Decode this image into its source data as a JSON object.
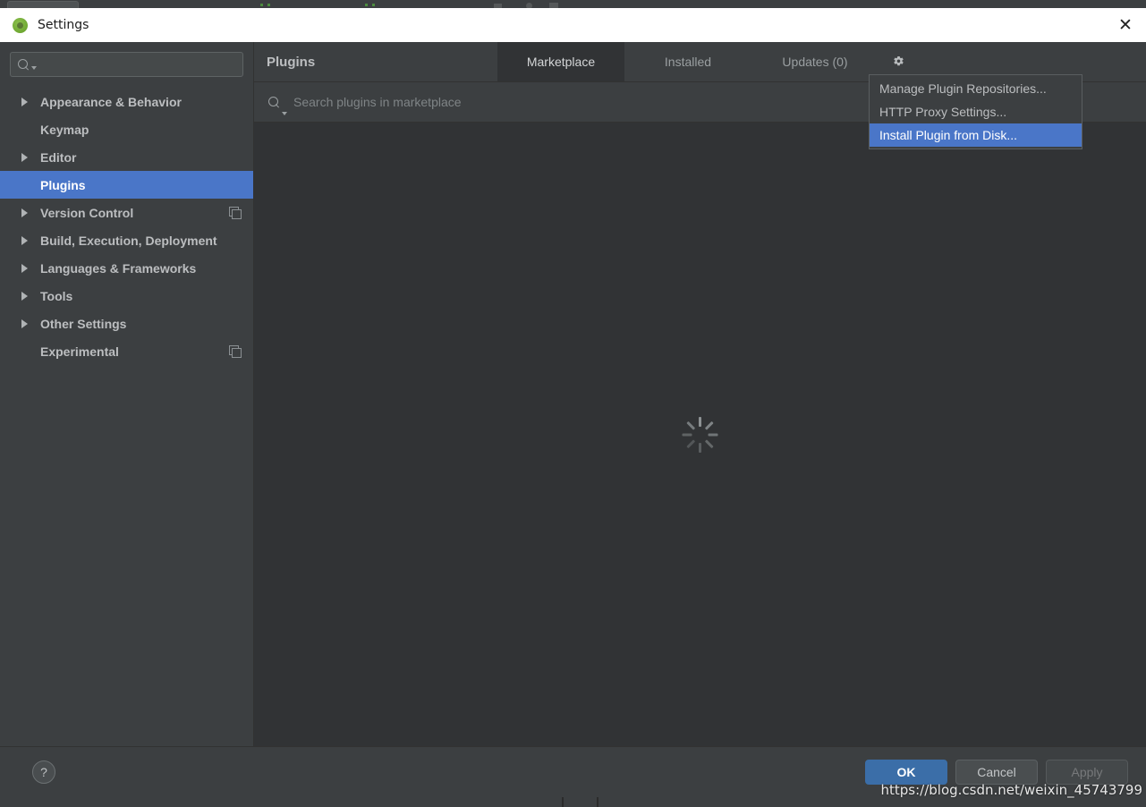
{
  "window": {
    "title": "Settings",
    "app_icon": "android-studio-icon",
    "close_icon": "close-icon"
  },
  "sidebar": {
    "search": {
      "value": "",
      "placeholder": "",
      "icon": "search-icon"
    },
    "items": [
      {
        "label": "Appearance & Behavior",
        "expandable": true,
        "bold": true,
        "selected": false,
        "badge": ""
      },
      {
        "label": "Keymap",
        "expandable": false,
        "bold": true,
        "selected": false,
        "badge": ""
      },
      {
        "label": "Editor",
        "expandable": true,
        "bold": true,
        "selected": false,
        "badge": ""
      },
      {
        "label": "Plugins",
        "expandable": false,
        "bold": true,
        "selected": true,
        "badge": ""
      },
      {
        "label": "Version Control",
        "expandable": true,
        "bold": true,
        "selected": false,
        "badge": "project-settings-icon"
      },
      {
        "label": "Build, Execution, Deployment",
        "expandable": true,
        "bold": true,
        "selected": false,
        "badge": ""
      },
      {
        "label": "Languages & Frameworks",
        "expandable": true,
        "bold": true,
        "selected": false,
        "badge": ""
      },
      {
        "label": "Tools",
        "expandable": true,
        "bold": true,
        "selected": false,
        "badge": ""
      },
      {
        "label": "Other Settings",
        "expandable": true,
        "bold": true,
        "selected": false,
        "badge": ""
      },
      {
        "label": "Experimental",
        "expandable": false,
        "bold": true,
        "selected": false,
        "badge": "project-settings-icon"
      }
    ]
  },
  "main": {
    "page_title": "Plugins",
    "tabs": [
      {
        "label": "Marketplace",
        "active": true
      },
      {
        "label": "Installed",
        "active": false
      },
      {
        "label": "Updates (0)",
        "active": false
      }
    ],
    "gear_icon": "gear-icon",
    "search": {
      "value": "",
      "placeholder": "Search plugins in marketplace",
      "icon": "search-icon"
    },
    "loading_indicator": "loading-spinner"
  },
  "gear_menu": {
    "items": [
      {
        "label": "Manage Plugin Repositories...",
        "highlighted": false
      },
      {
        "label": "HTTP Proxy Settings...",
        "highlighted": false
      },
      {
        "label": "Install Plugin from Disk...",
        "highlighted": true
      }
    ]
  },
  "footer": {
    "help_label": "?",
    "buttons": [
      {
        "label": "OK",
        "style": "primary"
      },
      {
        "label": "Cancel",
        "style": "normal"
      },
      {
        "label": "Apply",
        "style": "disabled"
      }
    ]
  },
  "watermark": "https://blog.csdn.net/weixin_45743799",
  "colors": {
    "dialog_bg": "#3c3f41",
    "content_bg": "#313335",
    "selection_blue": "#4a76c8",
    "primary_button": "#3b6ea8",
    "text": "#bcbec0",
    "titlebar_bg": "#ffffff"
  }
}
